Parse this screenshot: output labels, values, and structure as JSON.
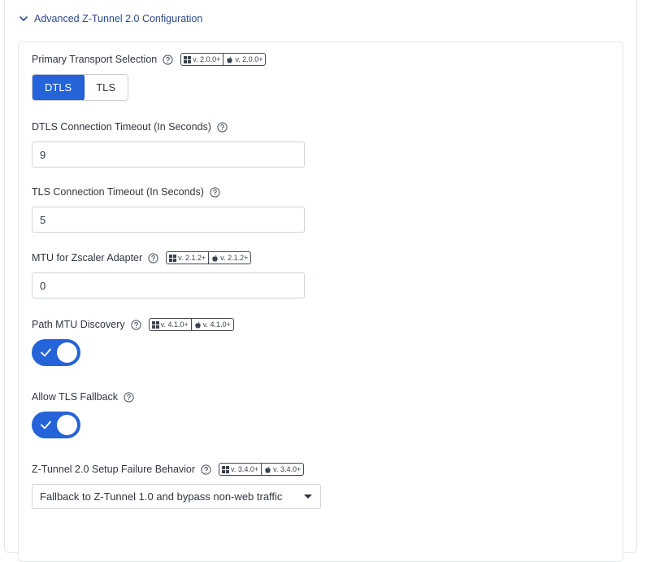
{
  "section": {
    "title": "Advanced Z-Tunnel 2.0 Configuration"
  },
  "icons": {
    "help": "help-circle-icon",
    "windows": "windows-icon",
    "apple": "apple-icon",
    "chevron": "chevron-down-icon",
    "check": "check-icon"
  },
  "colors": {
    "accent": "#2563d8",
    "section_title": "#2d4a8a"
  },
  "fields": {
    "transport": {
      "label": "Primary Transport Selection",
      "win_version": "v. 2.0.0+",
      "mac_version": "v. 2.0.0+",
      "options": [
        "DTLS",
        "TLS"
      ],
      "selected": "DTLS"
    },
    "dtls_timeout": {
      "label": "DTLS Connection Timeout (In Seconds)",
      "value": "9"
    },
    "tls_timeout": {
      "label": "TLS Connection Timeout (In Seconds)",
      "value": "5"
    },
    "mtu": {
      "label": "MTU for Zscaler Adapter",
      "win_version": "v. 2.1.2+",
      "mac_version": "v. 2.1.2+",
      "value": "0"
    },
    "path_mtu": {
      "label": "Path MTU Discovery",
      "win_version": "v. 4.1.0+",
      "mac_version": "v. 4.1.0+",
      "enabled": true
    },
    "tls_fallback": {
      "label": "Allow TLS Fallback",
      "enabled": true
    },
    "failure_behavior": {
      "label": "Z-Tunnel 2.0 Setup Failure Behavior",
      "win_version": "v. 3.4.0+",
      "mac_version": "v. 3.4.0+",
      "value": "Fallback to Z-Tunnel 1.0 and bypass non-web traffic"
    }
  }
}
